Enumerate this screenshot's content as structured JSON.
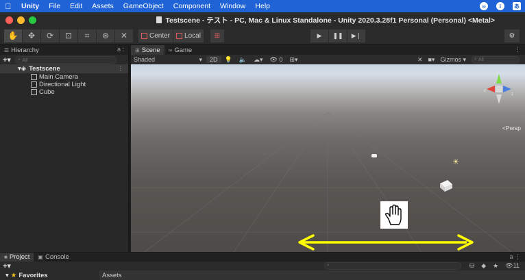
{
  "menubar": {
    "apple": "",
    "app_name": "Unity",
    "items": [
      "File",
      "Edit",
      "Assets",
      "GameObject",
      "Component",
      "Window",
      "Help"
    ]
  },
  "window": {
    "title": "Testscene - テスト - PC, Mac & Linux Standalone - Unity 2020.3.28f1 Personal (Personal) <Metal>"
  },
  "toolbar": {
    "pivot_label": "Center",
    "space_label": "Local"
  },
  "hierarchy": {
    "tab_label": "Hierarchy",
    "lock_glyph": "a :",
    "search_placeholder": "All",
    "scene_name": "Testscene",
    "items": [
      "Main Camera",
      "Directional Light",
      "Cube"
    ]
  },
  "scene_view": {
    "tabs": [
      "Scene",
      "Game"
    ],
    "shading_mode": "Shaded",
    "btn_2d": "2D",
    "gizmos_label": "Gizmos",
    "search_placeholder": "All",
    "persp_label": "Persp",
    "hidden_count": "0",
    "gizmo_axes": [
      "y",
      "x",
      "z"
    ],
    "annotation": {
      "hand_icon": "hand-pan-icon",
      "arrow_color": "#ffff00",
      "arrow_type": "double-headed-horizontal"
    }
  },
  "bottom_panel": {
    "tabs": [
      "Project",
      "Console"
    ],
    "favorites_label": "Favorites",
    "assets_label": "Assets",
    "hidden_count": "11"
  },
  "colors": {
    "menubar": "#1f63d6",
    "accent_yellow": "#ffff00",
    "traffic_red": "#fe5f57",
    "traffic_yellow": "#febb2e",
    "traffic_green": "#28c840"
  }
}
